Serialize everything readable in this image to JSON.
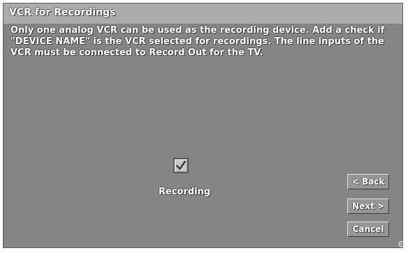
{
  "dialog": {
    "title": "VCR for Recordings",
    "description_lines": [
      "Only one analog VCR can be used as the recording device.  Add a check if",
      "\"DEVICE NAME\" is the VCR selected for recordings.  The line inputs of the",
      "VCR must be connected to Record Out for the TV."
    ]
  },
  "recording_checkbox": {
    "label": "Recording",
    "checked": true,
    "icon": "checkmark-icon"
  },
  "buttons": {
    "back_label": "< Back",
    "next_label": "Next >",
    "cancel_label": "Cancel"
  },
  "colors": {
    "panel": "#8f8f8f",
    "titlebar": "#b6b6b6",
    "text": "#ffffff",
    "button_face": "#a0a0a0"
  }
}
